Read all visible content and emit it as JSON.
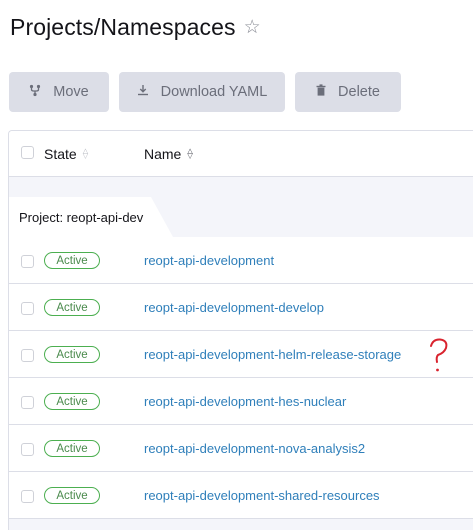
{
  "header": {
    "title": "Projects/Namespaces",
    "favorite_icon": "star-icon"
  },
  "toolbar": {
    "move_label": "Move",
    "download_label": "Download YAML",
    "delete_label": "Delete"
  },
  "table": {
    "columns": [
      {
        "label": "State",
        "sort": "unsorted"
      },
      {
        "label": "Name",
        "sort": "sorted"
      }
    ],
    "group": {
      "label": "Project: reopt-api-dev"
    },
    "rows": [
      {
        "state": "Active",
        "name": "reopt-api-development"
      },
      {
        "state": "Active",
        "name": "reopt-api-development-develop"
      },
      {
        "state": "Active",
        "name": "reopt-api-development-helm-release-storage"
      },
      {
        "state": "Active",
        "name": "reopt-api-development-hes-nuclear"
      },
      {
        "state": "Active",
        "name": "reopt-api-development-nova-analysis2"
      },
      {
        "state": "Active",
        "name": "reopt-api-development-shared-resources"
      }
    ]
  },
  "colors": {
    "button_bg": "#dcdee7",
    "link": "#2f7fba",
    "active_badge": "#4caf50",
    "annotation": "#d9232e"
  }
}
